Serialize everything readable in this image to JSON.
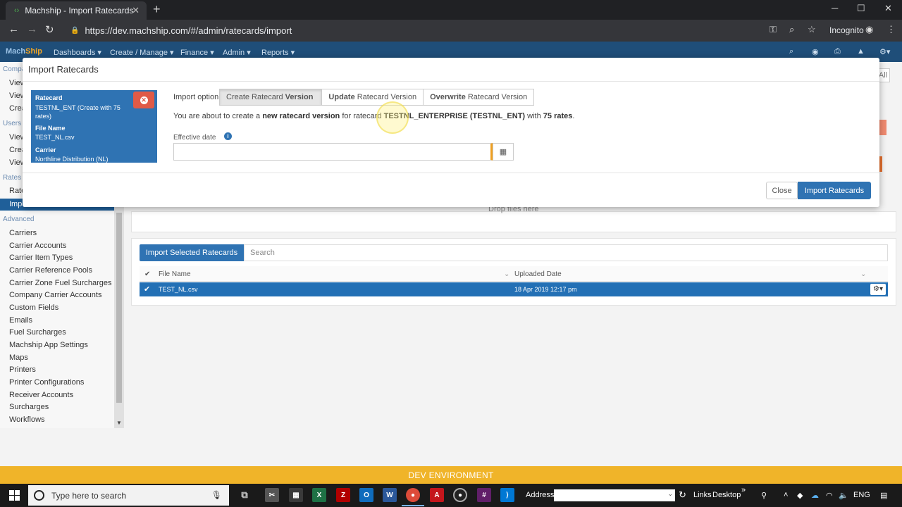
{
  "browser": {
    "tab_title": "Machship - Import Ratecards",
    "url": "https://dev.machship.com/#/admin/ratecards/import",
    "incognito_label": "Incognito"
  },
  "appnav": {
    "brand_a": "Mach",
    "brand_b": "Ship",
    "items": [
      "Dashboards ▾",
      "Create / Manage ▾",
      "Finance ▾",
      "Admin ▾",
      "Reports ▾"
    ]
  },
  "sidebar": {
    "heads": [
      "Compa",
      "Users",
      "Rates",
      "Advanced"
    ],
    "cut_items": [
      "View",
      "View",
      "Crea",
      "View",
      "Crea",
      "View",
      "Rate"
    ],
    "active_item": "Impo",
    "items": [
      "Carriers",
      "Carrier Accounts",
      "Carrier Item Types",
      "Carrier Reference Pools",
      "Carrier Zone Fuel Surcharges",
      "Company Carrier Accounts",
      "Custom Fields",
      "Emails",
      "Fuel Surcharges",
      "Machship App Settings",
      "Maps",
      "Printers",
      "Printer Configurations",
      "Receiver Accounts",
      "Surcharges",
      "Workflows"
    ]
  },
  "main": {
    "drop_text": "Drop files here",
    "all_btn": "All",
    "import_selected_label": "Import Selected Ratecards",
    "search_placeholder": "Search",
    "grid_headers": {
      "file_name": "File Name",
      "uploaded_date": "Uploaded Date"
    },
    "rows": [
      {
        "file_name": "TEST_NL.csv",
        "uploaded_date": "18 Apr 2019 12:17 pm"
      }
    ]
  },
  "modal": {
    "title": "Import Ratecards",
    "card": {
      "ratecard_label": "Ratecard",
      "ratecard_value": "TESTNL_ENT (Create with 75 rates)",
      "file_label": "File Name",
      "file_value": "TEST_NL.csv",
      "carrier_label": "Carrier",
      "carrier_value": "Northline Distribution (NL)"
    },
    "import_option_label": "Import option",
    "options": [
      {
        "verb": "Create",
        "rest": "Ratecard",
        "strong": "Version",
        "active": true
      },
      {
        "verb": "Update",
        "rest": "Ratecard Version",
        "active": false
      },
      {
        "verb": "Overwrite",
        "rest": "Ratecard Version",
        "active": false
      }
    ],
    "desc": {
      "p1": "You are about to create a ",
      "b1": "new ratecard version",
      "p2": " for ratecard ",
      "b2": "TESTNL_ENTERPRISE (TESTNL_ENT)",
      "p3": " with ",
      "b3": "75 rates",
      "p4": "."
    },
    "effective_label": "Effective date",
    "effective_value": "",
    "close_label": "Close",
    "import_label": "Import Ratecards"
  },
  "dev_banner": "DEV ENVIRONMENT",
  "taskbar": {
    "search_placeholder": "Type here to search",
    "address_label": "Address",
    "links_label": "Links",
    "desktop_label": "Desktop",
    "lang": "ENG"
  }
}
